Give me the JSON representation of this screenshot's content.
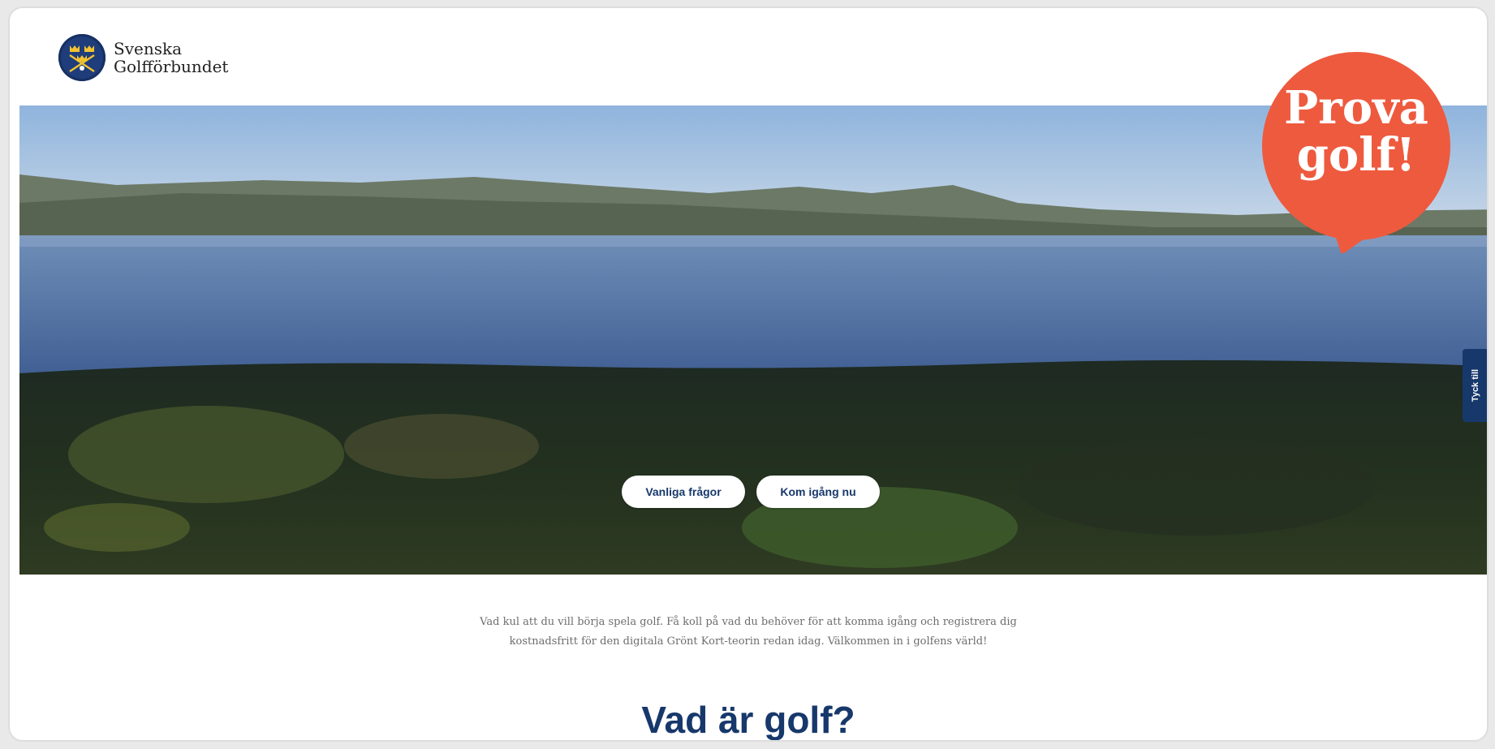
{
  "brand": {
    "line1": "Svenska",
    "line2": "Golfförbundet",
    "logo_icon": "crown-crest-icon",
    "color": "#1f3d7a"
  },
  "hero": {
    "button_faq": "Vanliga frågor",
    "button_start": "Kom igång nu"
  },
  "badge": {
    "line1": "Prova",
    "line2": "golf!",
    "color": "#ee5a3e"
  },
  "feedback_tab": "Tyck till",
  "intro": {
    "line1": "Vad kul att du vill börja spela golf. Få koll på vad du behöver för att komma igång och registrera dig",
    "line2": "kostnadsfritt för den digitala Grönt Kort-teorin redan idag. Välkommen in i golfens värld!"
  },
  "section_title": "Vad är golf?",
  "colors": {
    "primary": "#17386b",
    "accent": "#ee5a3e"
  }
}
